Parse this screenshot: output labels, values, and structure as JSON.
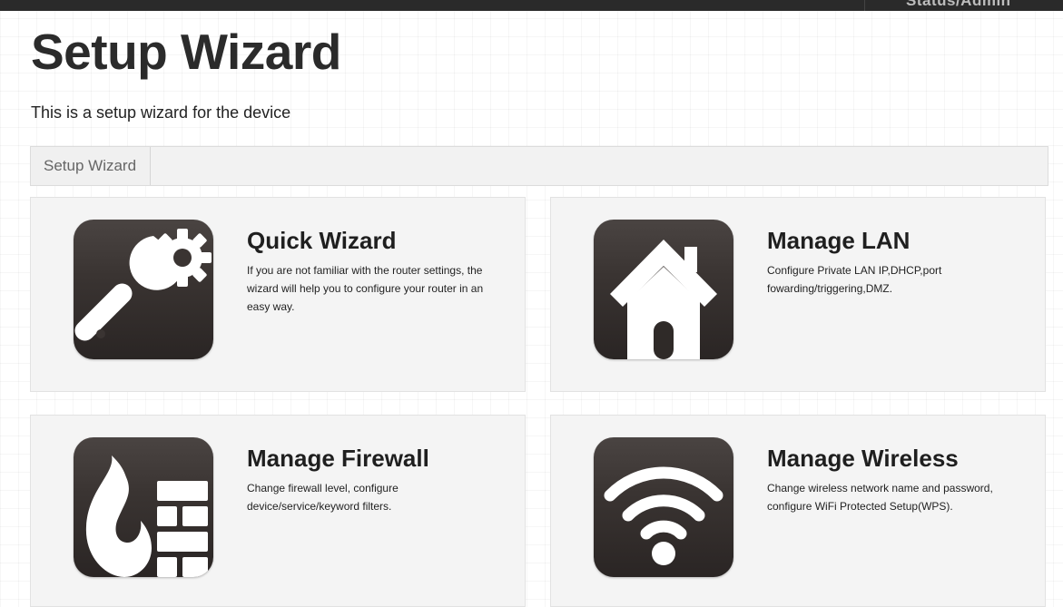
{
  "header": {
    "user_label": "Status/Admin"
  },
  "page": {
    "title": "Setup Wizard",
    "subtitle": "This is a setup wizard for the device"
  },
  "breadcrumb": {
    "current": "Setup Wizard"
  },
  "cards": [
    {
      "title": "Quick Wizard",
      "description": "If you are not familiar with the router settings, the wizard will help you to configure your router in an easy way.",
      "icon": "wrench-gear-icon"
    },
    {
      "title": "Manage LAN",
      "description": "Configure Private LAN IP,DHCP,port fowarding/triggering,DMZ.",
      "icon": "house-icon"
    },
    {
      "title": "Manage Firewall",
      "description": "Change firewall level, configure device/service/keyword filters.",
      "icon": "firewall-icon"
    },
    {
      "title": "Manage Wireless",
      "description": "Change wireless network name and password, configure WiFi Protected Setup(WPS).",
      "icon": "wifi-icon"
    }
  ],
  "colors": {
    "top_bar": "#2a2a2a",
    "icon_tile": "#3a3432",
    "card_background": "#f4f4f4"
  }
}
